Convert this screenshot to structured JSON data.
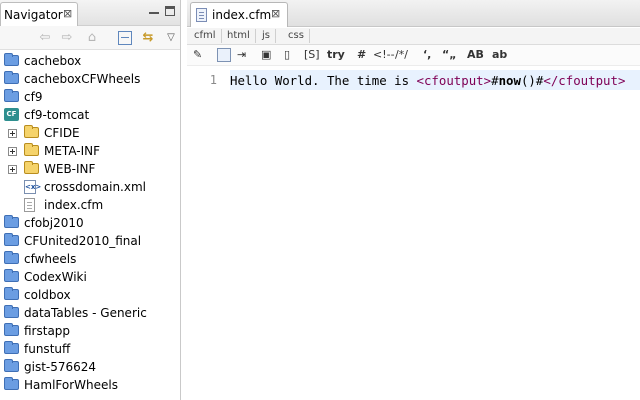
{
  "navigator": {
    "tab_title": "Navigator",
    "close_glyph": "⊠",
    "toolbar": [
      "back-arrow-icon",
      "forward-arrow-icon",
      "home-icon",
      "collapse-all-icon",
      "link-with-editor-icon",
      "view-menu-icon"
    ],
    "tree": [
      {
        "label": "cachebox",
        "type": "folder",
        "level": 0
      },
      {
        "label": "cacheboxCFWheels",
        "type": "folder",
        "level": 0
      },
      {
        "label": "cf9",
        "type": "folder",
        "level": 0
      },
      {
        "label": "cf9-tomcat",
        "type": "cf-project",
        "level": 0
      },
      {
        "label": "CFIDE",
        "type": "open-folder",
        "level": 1,
        "expandable": true
      },
      {
        "label": "META-INF",
        "type": "open-folder",
        "level": 1,
        "expandable": true
      },
      {
        "label": "WEB-INF",
        "type": "open-folder",
        "level": 1,
        "expandable": true
      },
      {
        "label": "crossdomain.xml",
        "type": "xml-file",
        "level": 1
      },
      {
        "label": "index.cfm",
        "type": "cfm-file",
        "level": 1
      },
      {
        "label": "cfobj2010",
        "type": "folder",
        "level": 0
      },
      {
        "label": "CFUnited2010_final",
        "type": "folder",
        "level": 0
      },
      {
        "label": "cfwheels",
        "type": "folder",
        "level": 0
      },
      {
        "label": "CodexWiki",
        "type": "folder",
        "level": 0
      },
      {
        "label": "coldbox",
        "type": "folder",
        "level": 0
      },
      {
        "label": "dataTables - Generic",
        "type": "folder",
        "level": 0
      },
      {
        "label": "firstapp",
        "type": "folder",
        "level": 0
      },
      {
        "label": "funstuff",
        "type": "folder",
        "level": 0
      },
      {
        "label": "gist-576624",
        "type": "folder",
        "level": 0
      },
      {
        "label": "HamlForWheels",
        "type": "folder",
        "level": 0
      }
    ]
  },
  "editor": {
    "tab_title": "index.cfm",
    "close_glyph": "⊠",
    "lang_tabs": [
      "cfml",
      "html",
      "js",
      "css"
    ],
    "toolbar": [
      {
        "id": "insert-tag",
        "label": "✎",
        "kind": "icon"
      },
      {
        "id": "tag-chooser",
        "label": "",
        "kind": "box"
      },
      {
        "id": "insert-block",
        "label": "⇥",
        "kind": "icon"
      },
      {
        "id": "preview",
        "label": "▣",
        "kind": "icon"
      },
      {
        "id": "variable",
        "label": "▯",
        "kind": "icon"
      },
      {
        "id": "script-block",
        "label": "[S]",
        "kind": "text"
      },
      {
        "id": "try-catch",
        "label": "try",
        "kind": "text-bold"
      },
      {
        "id": "hash",
        "label": "#",
        "kind": "text-bold"
      },
      {
        "id": "comment",
        "label": "<!--",
        "kind": "text"
      },
      {
        "id": "block-comment",
        "label": "/*/",
        "kind": "text"
      },
      {
        "id": "single-quote",
        "label": "‘,",
        "kind": "text-bold"
      },
      {
        "id": "double-quote",
        "label": "“„",
        "kind": "text-bold"
      },
      {
        "id": "uppercase",
        "label": "AB",
        "kind": "text-bold"
      },
      {
        "id": "lowercase",
        "label": "ab",
        "kind": "text-bold"
      }
    ],
    "line_number": "1",
    "code": {
      "text": "Hello World. The time is ",
      "open_tag": "<cfoutput>",
      "hash_open": "#",
      "function": "now",
      "parens": "()",
      "hash_close": "#",
      "close_tag": "</cfoutput>"
    }
  },
  "colors": {
    "tag": "#7f0055",
    "current_line": "#e8f2fe",
    "folder_blue": "#6b9de2",
    "folder_yellow": "#f5d36b"
  }
}
